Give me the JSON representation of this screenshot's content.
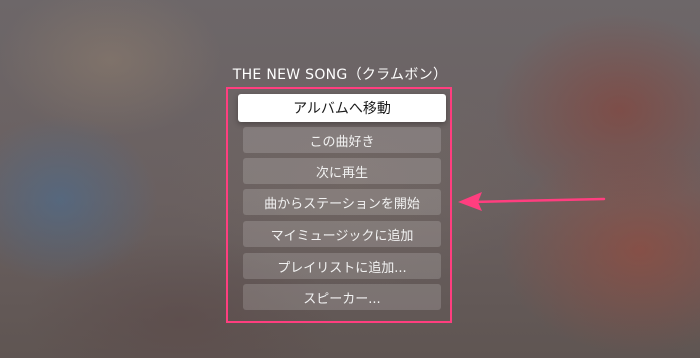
{
  "song": {
    "title": "THE NEW SONG（クラムボン）"
  },
  "menu": {
    "items": [
      {
        "label": "アルバムへ移動",
        "focused": true
      },
      {
        "label": "この曲好き",
        "focused": false
      },
      {
        "label": "次に再生",
        "focused": false
      },
      {
        "label": "曲からステーションを開始",
        "focused": false
      },
      {
        "label": "マイミュージックに追加",
        "focused": false
      },
      {
        "label": "プレイリストに追加...",
        "focused": false
      },
      {
        "label": "スピーカー...",
        "focused": false
      }
    ]
  },
  "annotation": {
    "highlight_color": "#ff3e7f",
    "arrow_color": "#ff3e7f",
    "arrow_icon": "arrow-left-icon"
  }
}
